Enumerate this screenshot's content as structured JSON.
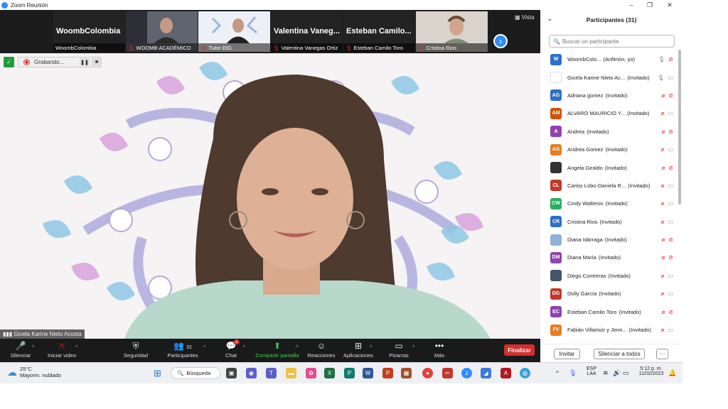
{
  "window": {
    "title": "Zoom Reunión",
    "controls": {
      "minimize": "–",
      "restore": "❐",
      "close": "✕"
    }
  },
  "strip": {
    "tiles": [
      {
        "big": "WoombColombia",
        "label": "WoombColombia",
        "muted": false
      },
      {
        "big": "",
        "label": "WOOMB ACADÉMICO",
        "muted": true
      },
      {
        "big": "",
        "label": "Tutor EIG",
        "muted": true
      },
      {
        "big": "Valentina Vaneg...",
        "label": "Valentina Vanegas Ortiz",
        "muted": true
      },
      {
        "big": "Esteban Camilo...",
        "label": "Esteban Camilo Toro",
        "muted": true
      },
      {
        "big": "",
        "label": "Cristina Rios",
        "muted": true
      }
    ],
    "view_label": "Vista"
  },
  "recording": {
    "label": "Grabando..."
  },
  "speaker_name": "Gicela Karine Nieto Acosta",
  "toolbar": {
    "mute": "Silenciar",
    "video": "Iniciar video",
    "security": "Seguridad",
    "participants": "Participantes",
    "participants_count": "31",
    "chat": "Chat",
    "chat_badge": "2",
    "share": "Compartir pantalla",
    "reactions": "Reacciones",
    "apps": "Aplicaciones",
    "whiteboards": "Pizarras",
    "more": "Más",
    "end": "Finalizar"
  },
  "panel": {
    "title": "Participantes (31)",
    "search_placeholder": "Buscar un participante",
    "participants": [
      {
        "initials": "W",
        "color": "#2d6fc7",
        "name": "WoombColo...",
        "role": "(Anfitrión, yo)",
        "mic": "on",
        "cam": "off"
      },
      {
        "initials": "",
        "color": "#ffffff",
        "name": "Gicela Karine Nieto Ac...",
        "role": "(Invitado)",
        "mic": "on",
        "cam": "on"
      },
      {
        "initials": "AG",
        "color": "#2d6fc7",
        "name": "Adriana gomez",
        "role": "(Invitado)",
        "mic": "off",
        "cam": "off"
      },
      {
        "initials": "AM",
        "color": "#d35400",
        "name": "ALVARO MAURICIO Y...",
        "role": "(Invitado)",
        "mic": "off",
        "cam": "on"
      },
      {
        "initials": "A",
        "color": "#8e44ad",
        "name": "Andrea",
        "role": "(Invitado)",
        "mic": "off",
        "cam": "off"
      },
      {
        "initials": "AG",
        "color": "#e67e22",
        "name": "Andrea Gomez",
        "role": "(Invitado)",
        "mic": "off",
        "cam": "on"
      },
      {
        "initials": "",
        "color": "#333333",
        "name": "Angela Giraldo",
        "role": "(Invitado)",
        "mic": "off",
        "cam": "off"
      },
      {
        "initials": "CL",
        "color": "#c0392b",
        "name": "Carlos Lobo-Daniela R...",
        "role": "(Invitado)",
        "mic": "off",
        "cam": "on"
      },
      {
        "initials": "CW",
        "color": "#27ae60",
        "name": "Cindy Walteros",
        "role": "(Invitado)",
        "mic": "off",
        "cam": "on"
      },
      {
        "initials": "CR",
        "color": "#2d6fc7",
        "name": "Cristina Rios",
        "role": "(Invitado)",
        "mic": "off",
        "cam": "on"
      },
      {
        "initials": "",
        "color": "#8fb3d9",
        "name": "Diana Idárraga",
        "role": "(Invitado)",
        "mic": "off",
        "cam": "off"
      },
      {
        "initials": "DM",
        "color": "#8e44ad",
        "name": "Diana María",
        "role": "(Invitado)",
        "mic": "off",
        "cam": "off"
      },
      {
        "initials": "",
        "color": "#445566",
        "name": "Diego Contreras",
        "role": "(Invitado)",
        "mic": "off",
        "cam": "on"
      },
      {
        "initials": "DG",
        "color": "#c0392b",
        "name": "Dolly García",
        "role": "(Invitado)",
        "mic": "off",
        "cam": "on"
      },
      {
        "initials": "EC",
        "color": "#8e44ad",
        "name": "Esteban Camilo Toro",
        "role": "(Invitado)",
        "mic": "off",
        "cam": "off"
      },
      {
        "initials": "FV",
        "color": "#e67e22",
        "name": "Fabián Villamizr y Jenn...",
        "role": "(Invitado)",
        "mic": "off",
        "cam": "on"
      }
    ],
    "invite": "Invitar",
    "mute_all": "Silenciar a todos",
    "more": "···"
  },
  "taskbar": {
    "temp": "25°C",
    "weather": "Mayorm. nublado",
    "search": "Búsqueda",
    "lang1": "ESP",
    "lang2": "LAA",
    "time": "5:12 p. m.",
    "date": "11/02/2023"
  }
}
